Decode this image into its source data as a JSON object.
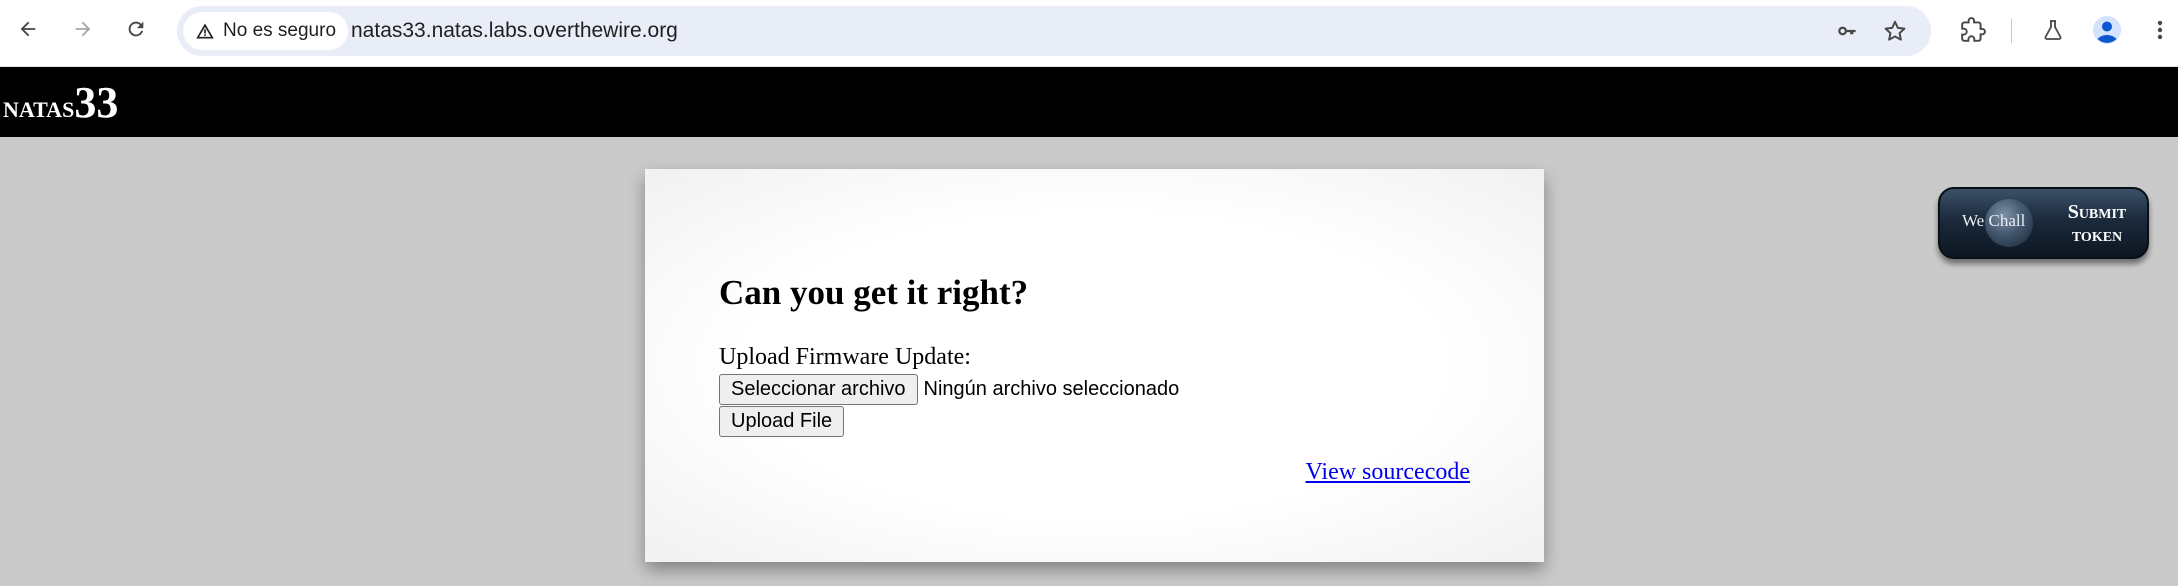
{
  "browser": {
    "security_label": "No es seguro",
    "url": "natas33.natas.labs.overthewire.org",
    "icons": [
      "back-arrow-icon",
      "forward-arrow-icon",
      "reload-icon",
      "warning-icon",
      "key-icon",
      "star-icon",
      "extensions-icon",
      "labs-flask-icon",
      "profile-avatar-icon",
      "more-menu-icon"
    ],
    "accent_color": "#1a73e8"
  },
  "header": {
    "logo_name": "natas",
    "logo_number": "33"
  },
  "content": {
    "title": "Can you get it right?",
    "upload_label": "Upload Firmware Update:",
    "choose_file_label": "Seleccionar archivo",
    "file_status": "Ningún archivo seleccionado",
    "upload_button_label": "Upload File",
    "source_link": "View sourcecode"
  },
  "wechall": {
    "brand_text": "We Chall",
    "submit_line1": "Submit",
    "submit_line2": "token"
  }
}
